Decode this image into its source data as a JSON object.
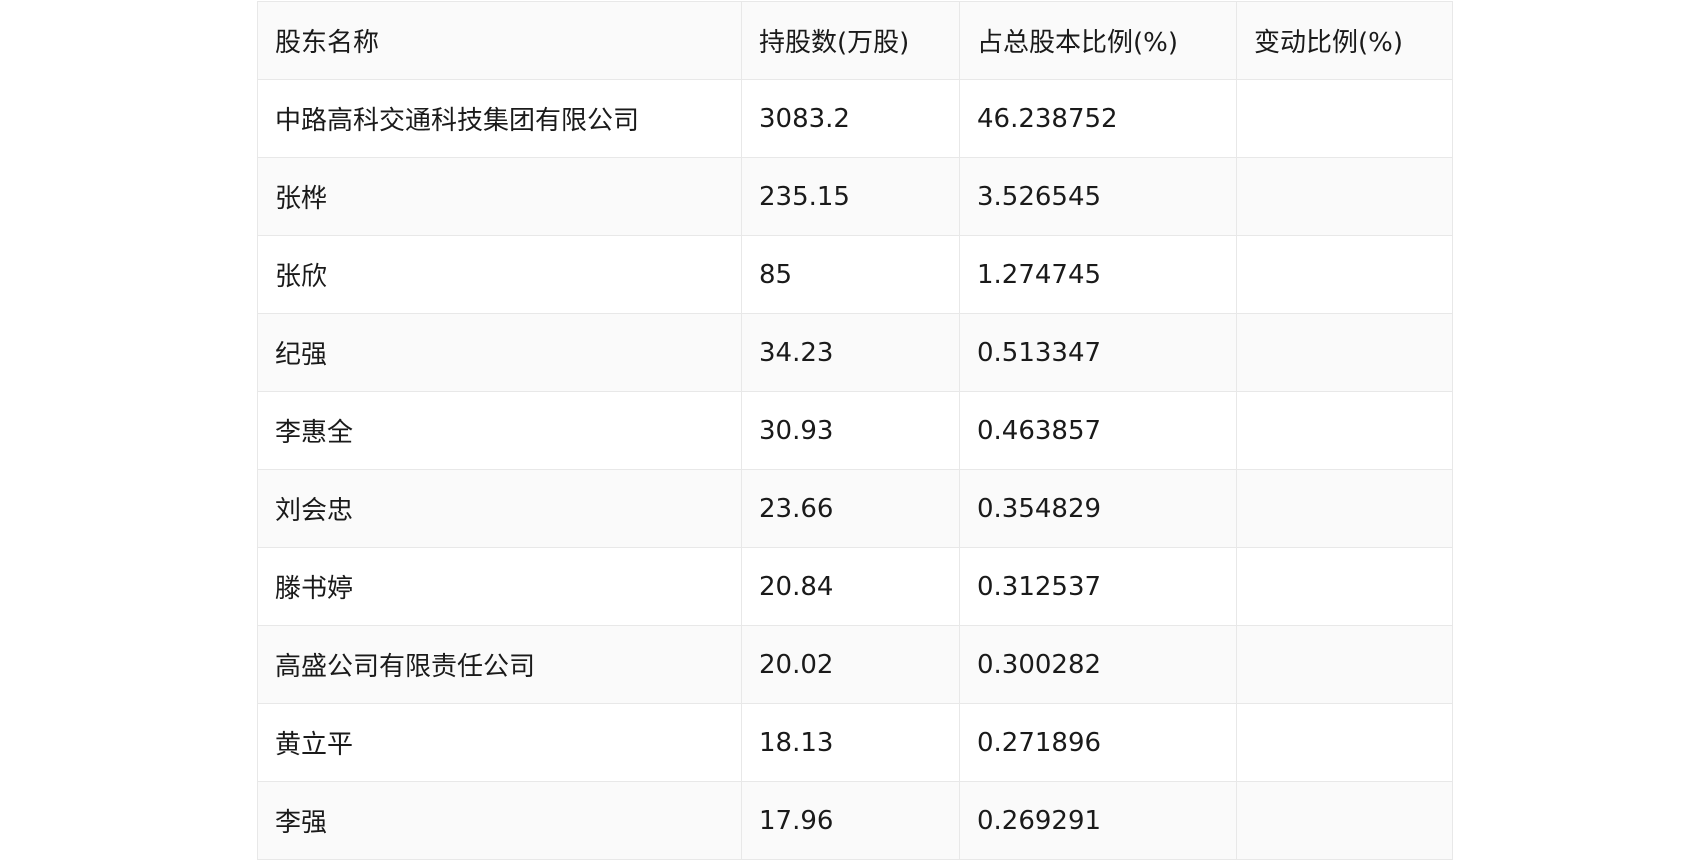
{
  "table": {
    "headers": [
      "股东名称",
      "持股数(万股)",
      "占总股本比例(%)",
      "变动比例(%)"
    ],
    "rows": [
      [
        "中路高科交通科技集团有限公司",
        "3083.2",
        "46.238752",
        ""
      ],
      [
        "张桦",
        "235.15",
        "3.526545",
        ""
      ],
      [
        "张欣",
        "85",
        "1.274745",
        ""
      ],
      [
        "纪强",
        "34.23",
        "0.513347",
        ""
      ],
      [
        "李惠全",
        "30.93",
        "0.463857",
        ""
      ],
      [
        "刘会忠",
        "23.66",
        "0.354829",
        ""
      ],
      [
        "滕书婷",
        "20.84",
        "0.312537",
        ""
      ],
      [
        "高盛公司有限责任公司",
        "20.02",
        "0.300282",
        ""
      ],
      [
        "黄立平",
        "18.13",
        "0.271896",
        ""
      ],
      [
        "李强",
        "17.96",
        "0.269291",
        ""
      ]
    ]
  }
}
